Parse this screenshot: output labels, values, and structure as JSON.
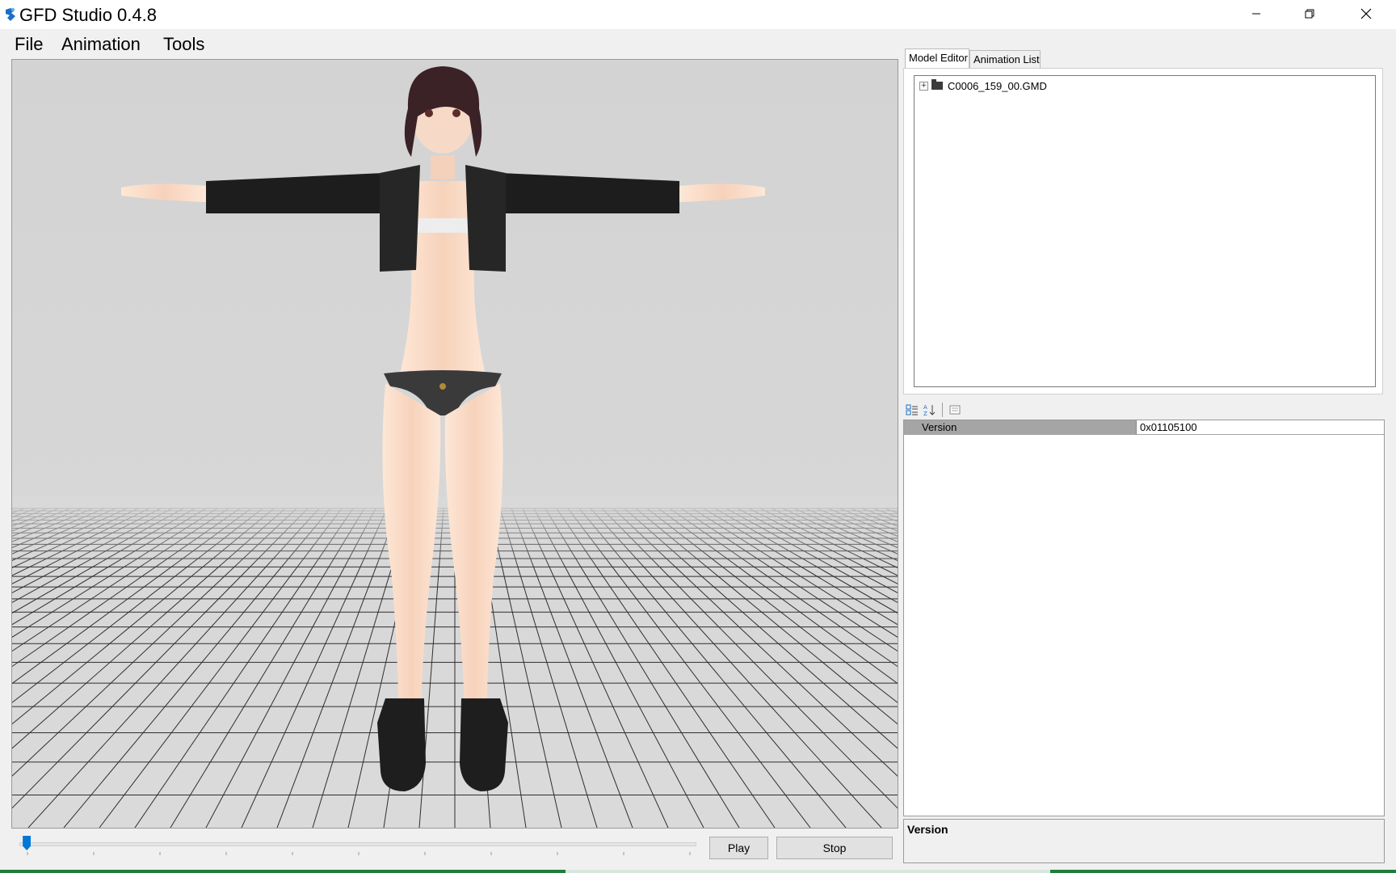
{
  "window": {
    "title": "GFD Studio 0.4.8"
  },
  "menu": {
    "items": [
      "File",
      "Animation",
      "Tools"
    ]
  },
  "playback": {
    "play_label": "Play",
    "stop_label": "Stop",
    "progress": 0.005
  },
  "tabs": {
    "model_editor": "Model Editor",
    "animation_list": "Animation List"
  },
  "tree": {
    "root_label": "C0006_159_00.GMD",
    "expander": "+"
  },
  "properties": {
    "rows": [
      {
        "name": "Version",
        "value": "0x01105100"
      }
    ]
  },
  "help": {
    "title": "Version"
  },
  "colors": {
    "accent": "#0078d7",
    "viewport_bg": "#d7d7d7",
    "selected_row": "#a5a5a5"
  }
}
